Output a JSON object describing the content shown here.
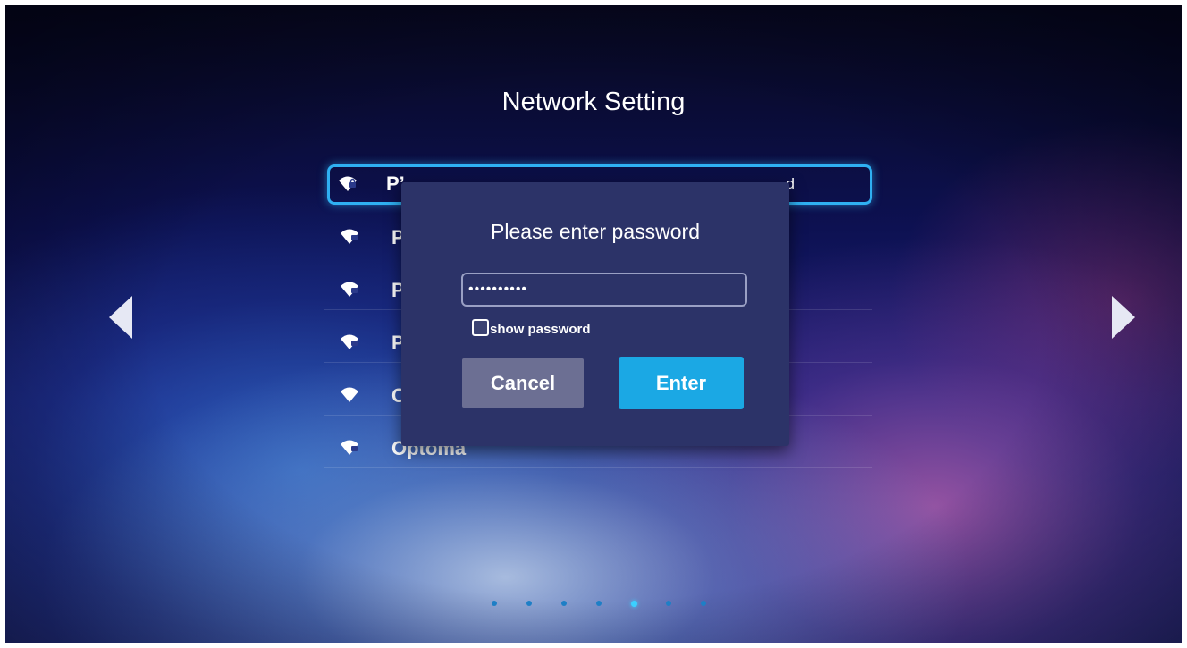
{
  "page": {
    "title": "Network Setting"
  },
  "networks": [
    {
      "name": "P’",
      "status": "d",
      "selected": true,
      "icon": "wifi-locked-icon"
    },
    {
      "name": "P",
      "status": "",
      "selected": false,
      "icon": "wifi-locked-icon"
    },
    {
      "name": "P",
      "status": "",
      "selected": false,
      "icon": "wifi-locked-icon"
    },
    {
      "name": "P",
      "status": "",
      "selected": false,
      "icon": "wifi-locked-icon"
    },
    {
      "name": "O",
      "status": "",
      "selected": false,
      "icon": "wifi-open-icon"
    },
    {
      "name": "Optoma",
      "status": "",
      "selected": false,
      "icon": "wifi-locked-icon"
    }
  ],
  "dialog": {
    "title": "Please enter password",
    "password_value": "••••••••••",
    "show_password_label": "show password",
    "show_password_checked": false,
    "cancel_label": "Cancel",
    "enter_label": "Enter"
  },
  "navigation": {
    "prev_icon": "chevron-left-icon",
    "next_icon": "chevron-right-icon"
  },
  "pagination": {
    "page_count": 7,
    "active_page": 5
  },
  "colors": {
    "accent": "#1ba8e4",
    "selection_border": "#2fb0f2",
    "dialog_bg": "#2c3368",
    "cancel_bg": "#6c6f93"
  }
}
